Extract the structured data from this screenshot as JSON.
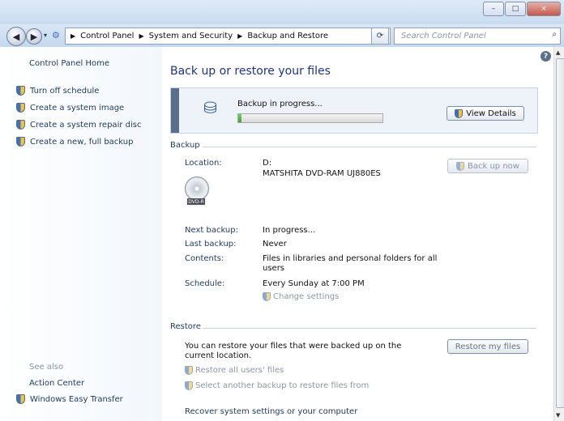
{
  "window": {
    "minimize": "–",
    "maximize": "□",
    "close": "×"
  },
  "nav": {
    "back_icon": "back-arrow-icon",
    "forward_icon": "forward-arrow-icon",
    "breadcrumbs": [
      "Control Panel",
      "System and Security",
      "Backup and Restore"
    ],
    "search_placeholder": "Search Control Panel"
  },
  "left_pane": {
    "home": "Control Panel Home",
    "tasks": [
      "Turn off schedule",
      "Create a system image",
      "Create a system repair disc",
      "Create a new, full backup"
    ],
    "see_also": "See also",
    "see_also_links": [
      "Action Center",
      "Windows Easy Transfer"
    ]
  },
  "main": {
    "title": "Back up or restore your files",
    "progress": {
      "label": "Backup in progress...",
      "value": 0.02,
      "button": "View Details"
    },
    "backup": {
      "heading": "Backup",
      "location_label": "Location:",
      "location_drive": "D:",
      "location_device": "MATSHITA DVD-RAM UJ880ES",
      "media_label": "DVD-R",
      "back_up_now": "Back up now",
      "next_backup_label": "Next backup:",
      "next_backup": "In progress...",
      "last_backup_label": "Last backup:",
      "last_backup": "Never",
      "contents_label": "Contents:",
      "contents": "Files in libraries and personal folders for all users",
      "schedule_label": "Schedule:",
      "schedule": "Every Sunday at 7:00 PM",
      "change_settings": "Change settings"
    },
    "restore": {
      "heading": "Restore",
      "description": "You can restore your files that were backed up on the current location.",
      "restore_my_files": "Restore my files",
      "restore_all_users": "Restore all users' files",
      "select_another": "Select another backup to restore files from",
      "recover": "Recover system settings or your computer"
    }
  },
  "colors": {
    "title_blue": "#1e3287",
    "link_text": "#1e395b",
    "disabled_text": "#8b96a5",
    "progress_green": "#37a537"
  }
}
